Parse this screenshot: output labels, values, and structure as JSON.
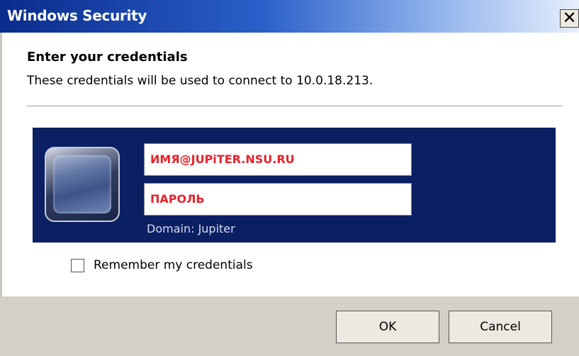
{
  "window": {
    "title": "Windows Security",
    "close_glyph": "✕"
  },
  "dialog": {
    "heading": "Enter your credentials",
    "subheading": "These credentials will be used to connect to 10.0.18.213."
  },
  "credentials": {
    "username_value": "ИМЯ@JUPiTER.NSU.RU",
    "password_value": "ПАРОЛЬ",
    "domain_text": "Domain: Jupiter",
    "user_icon": "user-tile-icon"
  },
  "remember": {
    "label": "Remember my credentials",
    "checked": false
  },
  "buttons": {
    "ok_label": "OK",
    "cancel_label": "Cancel"
  },
  "colors": {
    "title_start": "#0a2c8c",
    "panel_bg": "#0b1f63",
    "field_text": "#e8222b",
    "footer_bg": "#d4d0c8"
  }
}
